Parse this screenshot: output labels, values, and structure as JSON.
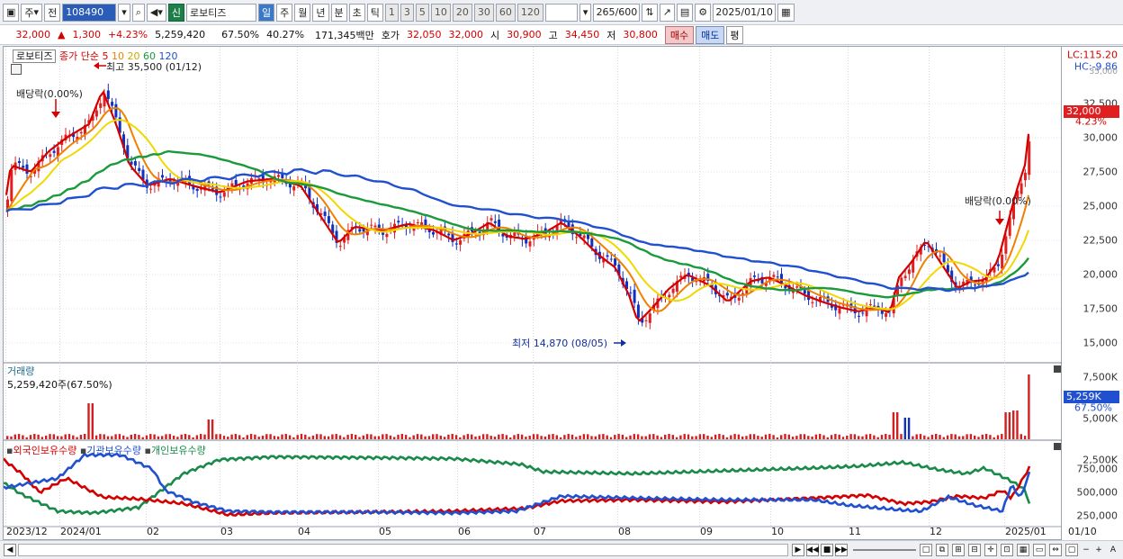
{
  "toolbar": {
    "market": "주",
    "prev_label": "전",
    "code": "108490",
    "credit_label": "신",
    "name": "로보티즈",
    "periods": [
      "일",
      "주",
      "월",
      "년",
      "분",
      "초",
      "틱"
    ],
    "intervals": [
      "1",
      "3",
      "5",
      "10",
      "20",
      "30",
      "60",
      "120"
    ],
    "count": "265",
    "count_total": "/600",
    "date": "2025/01/10"
  },
  "info": {
    "price": "32,000",
    "change": "1,300",
    "change_pct": "+4.23%",
    "volume": "5,259,420",
    "vol_ratio": "67.50%",
    "turnover": "40.27%",
    "amount": "171,345백만",
    "quote_label": "호가",
    "quote1": "32,050",
    "quote2": "32,000",
    "open_label": "시",
    "open": "30,900",
    "high_label": "고",
    "high": "34,450",
    "low_label": "저",
    "low": "30,800",
    "buy": "매수",
    "sell": "매도",
    "avg": "평"
  },
  "price_panel": {
    "legend_name": "로보티즈",
    "legend_ma": "종가 단순",
    "ma_periods": [
      "5",
      "10",
      "20",
      "60",
      "120"
    ],
    "ma_colors": [
      "#d40000",
      "#f08000",
      "#e8c800",
      "#1a9a3a",
      "#2050d0"
    ],
    "high_annotation": "최고 35,500 (01/12)",
    "low_annotation": "최저 14,870 (08/05)",
    "dividend1": "배당락(0.00%)",
    "dividend2": "배당락(0.00%)",
    "y_ticks": [
      "32,500",
      "30,000",
      "27,500",
      "25,000",
      "22,500",
      "20,000",
      "17,500",
      "15,000"
    ],
    "lc": "LC:115.20",
    "hc": "HC:-9.86",
    "top_tick": "35,000",
    "current_tag": "32,000",
    "current_pct": "4.23%"
  },
  "volume_panel": {
    "title": "거래량",
    "value": "5,259,420주(67.50%)",
    "y_ticks": [
      "7,500K",
      "5,000K",
      "2,500K"
    ],
    "current_tag": "5,259K",
    "current_pct": "67.50%"
  },
  "holding_panel": {
    "legend": [
      "외국인보유수량",
      "기관보유수량",
      "개인보유수량"
    ],
    "colors": [
      "#d40000",
      "#2050d0",
      "#1a8a4a"
    ],
    "y_ticks": [
      "750,000",
      "500,000",
      "250,000"
    ]
  },
  "x_axis": [
    "2023/12",
    "2024/01",
    "02",
    "03",
    "04",
    "05",
    "06",
    "07",
    "08",
    "09",
    "10",
    "11",
    "12",
    "2025/01"
  ],
  "x_axis_right": "01/10"
}
